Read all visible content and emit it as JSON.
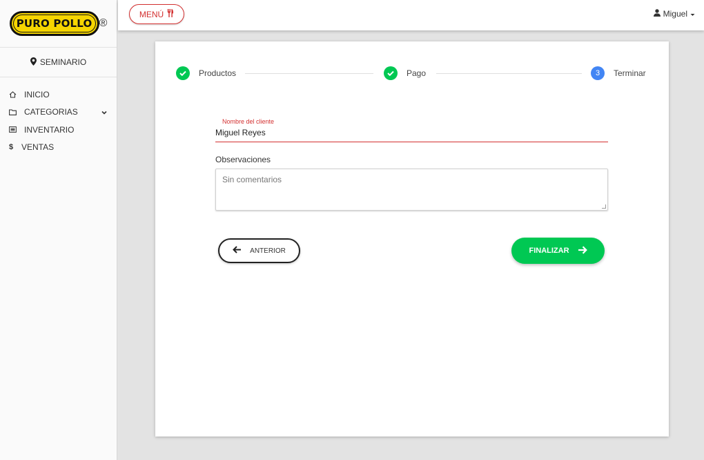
{
  "brand": {
    "logo_text": "PURO POLLO",
    "registered": "®",
    "color": "#f6d500"
  },
  "branch": {
    "icon": "map-pin-icon",
    "name": "SEMINARIO"
  },
  "nav": [
    {
      "icon": "home-icon",
      "label": "INICIO"
    },
    {
      "icon": "folder-icon",
      "label": "CATEGORIAS",
      "expandable": true
    },
    {
      "icon": "list-icon",
      "label": "INVENTARIO"
    },
    {
      "icon": "dollar-icon",
      "label": "VENTAS"
    }
  ],
  "topbar": {
    "menu_label": "MENÚ",
    "menu_icon": "utensils-icon",
    "user_name": "Miguel"
  },
  "stepper": {
    "steps": [
      {
        "label": "Productos",
        "state": "done"
      },
      {
        "label": "Pago",
        "state": "done"
      },
      {
        "label": "Terminar",
        "state": "active",
        "number": "3"
      }
    ]
  },
  "form": {
    "client_label": "Nombre del cliente",
    "client_value": "Miguel Reyes",
    "obs_label": "Observaciones",
    "obs_placeholder": "Sin comentarios"
  },
  "actions": {
    "prev_label": "ANTERIOR",
    "next_label": "FINALIZAR"
  },
  "colors": {
    "accent_red": "#d32f2f",
    "success_green": "#00c853",
    "step_blue": "#4285f4"
  }
}
